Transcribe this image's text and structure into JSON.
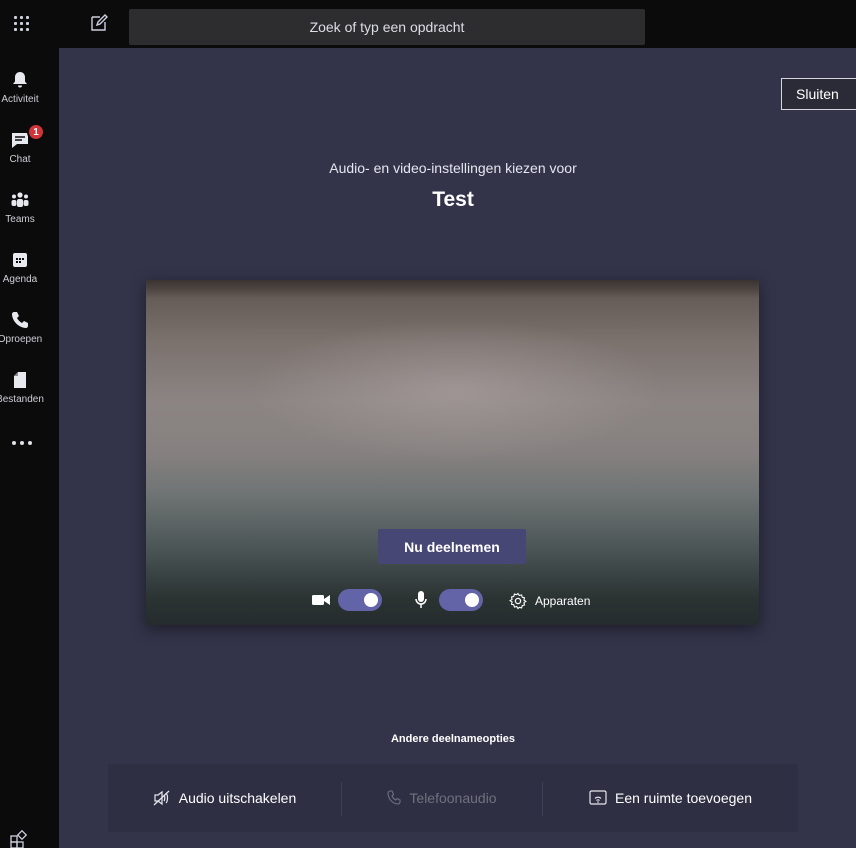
{
  "topbar": {
    "search_placeholder": "Zoek of typ een opdracht"
  },
  "rail": {
    "items": [
      {
        "label": "Activiteit",
        "icon": "bell-icon"
      },
      {
        "label": "Chat",
        "icon": "chat-icon",
        "badge": "1"
      },
      {
        "label": "Teams",
        "icon": "teams-icon"
      },
      {
        "label": "Agenda",
        "icon": "calendar-icon"
      },
      {
        "label": "Oproepen",
        "icon": "phone-icon"
      },
      {
        "label": "Bestanden",
        "icon": "file-icon"
      }
    ]
  },
  "main": {
    "close_label": "Sluiten",
    "subtitle": "Audio- en video-instellingen kiezen voor",
    "meeting_name": "Test",
    "join_label": "Nu deelnemen",
    "devices_label": "Apparaten",
    "camera_on": true,
    "mic_on": true
  },
  "other_options": {
    "title": "Andere deelnameopties",
    "audio_off": "Audio uitschakelen",
    "phone_audio": "Telefoonaudio",
    "add_room": "Een ruimte toevoegen"
  },
  "colors": {
    "accent": "#6264a7",
    "join_button": "#464775",
    "badge": "#d13438",
    "background": "#33344a"
  }
}
